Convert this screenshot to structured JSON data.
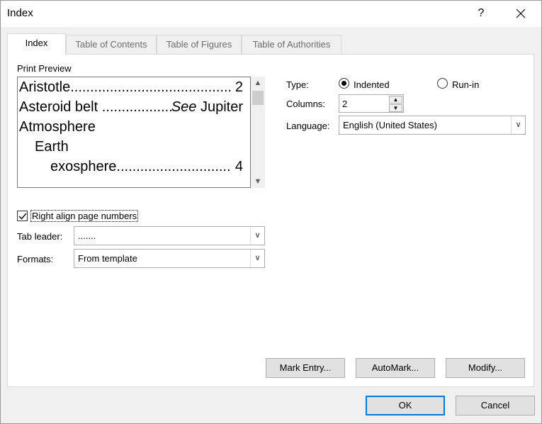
{
  "window": {
    "title": "Index",
    "help_label": "?",
    "close_label": "✕"
  },
  "tabs": [
    {
      "label": "Index",
      "active": true
    },
    {
      "label": "Table of Contents",
      "active": false
    },
    {
      "label": "Table of Figures",
      "active": false
    },
    {
      "label": "Table of Authorities",
      "active": false
    }
  ],
  "preview": {
    "label": "Print Preview",
    "entries": [
      {
        "text": "Aristotle",
        "page": "2"
      },
      {
        "text": "Asteroid belt",
        "see": "See",
        "ref": "Jupiter"
      },
      {
        "text": "Atmosphere"
      },
      {
        "text": "Earth"
      },
      {
        "text": "exosphere",
        "page": "4"
      }
    ]
  },
  "options": {
    "right_align_label": "Right align page numbers",
    "right_align_checked": true,
    "tab_leader_label": "Tab leader:",
    "tab_leader_value": ".......",
    "formats_label": "Formats:",
    "formats_value": "From template"
  },
  "type": {
    "label": "Type:",
    "indented_label": "Indented",
    "runin_label": "Run-in",
    "selected": "Indented"
  },
  "columns": {
    "label": "Columns:",
    "value": "2"
  },
  "language": {
    "label": "Language:",
    "value": "English (United States)"
  },
  "buttons": {
    "mark_entry": "Mark Entry...",
    "automark": "AutoMark...",
    "modify": "Modify...",
    "ok": "OK",
    "cancel": "Cancel"
  }
}
